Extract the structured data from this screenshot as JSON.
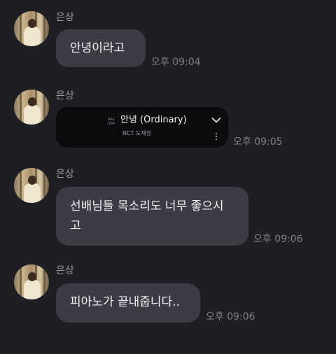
{
  "messages": [
    {
      "sender": "은상",
      "text": "안녕이라고",
      "time": "오후 09:04"
    },
    {
      "sender": "은상",
      "time": "오후 09:05",
      "music": {
        "badge_top": "AAC",
        "badge_bottom": "964",
        "title": "안녕 (Ordinary)",
        "artist": "NCT 도재정"
      }
    },
    {
      "sender": "은상",
      "line1": "선배님들 목소리도 너무 좋으시",
      "line2": "고",
      "time": "오후 09:06"
    },
    {
      "sender": "은상",
      "text": "피아노가 끝내줍니다..",
      "time": "오후 09:06"
    }
  ],
  "icons": {
    "expand": "chevron-down-icon",
    "more": "more-vertical-icon"
  },
  "colors": {
    "background": "#1e1f24",
    "bubble": "#3b3c44",
    "music_card": "#0c0c0f",
    "text": "#f2f2f4",
    "muted": "#7f8087"
  }
}
